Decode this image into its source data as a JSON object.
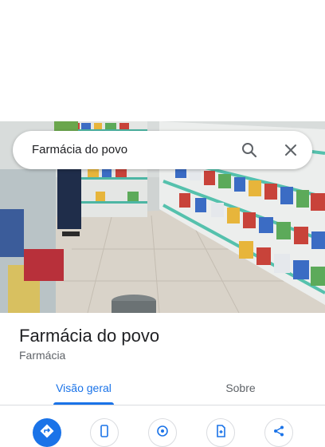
{
  "search": {
    "query": "Farmácia do povo"
  },
  "place": {
    "name": "Farmácia do povo",
    "category": "Farmácia"
  },
  "tabs": [
    {
      "label": "Visão geral",
      "active": true
    },
    {
      "label": "Sobre",
      "active": false
    }
  ],
  "actions": [
    {
      "icon": "directions-icon"
    },
    {
      "icon": "phone-icon"
    },
    {
      "icon": "location-icon"
    },
    {
      "icon": "save-icon"
    },
    {
      "icon": "share-icon"
    }
  ],
  "colors": {
    "accent": "#1a73e8",
    "text": "#202124",
    "muted": "#5f6368"
  }
}
